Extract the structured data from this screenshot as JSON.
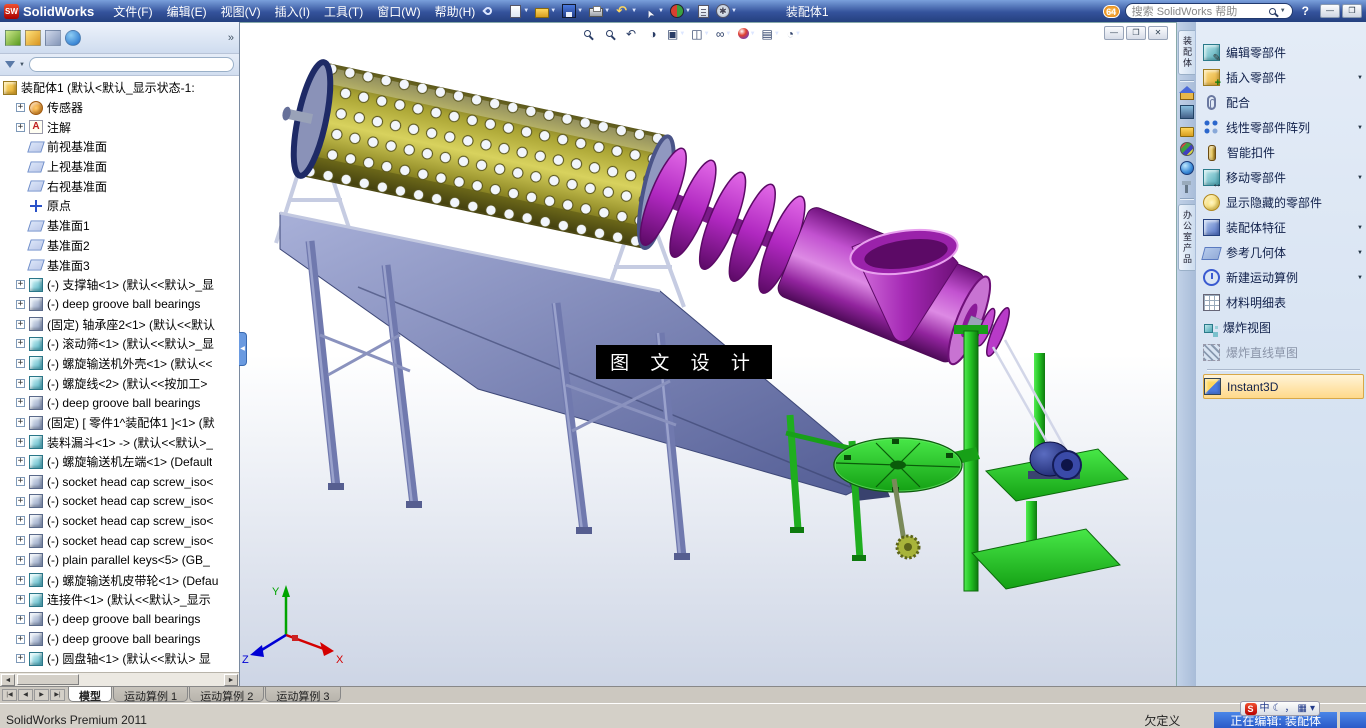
{
  "window": {
    "logo_badge": "SW",
    "logo_text": "SolidWorks",
    "menus": [
      "文件(F)",
      "编辑(E)",
      "视图(V)",
      "插入(I)",
      "工具(T)",
      "窗口(W)",
      "帮助(H)"
    ],
    "toolbar": [
      {
        "name": "new-document",
        "style": "doc",
        "arrow": true
      },
      {
        "name": "open-document",
        "style": "folder",
        "arrow": true
      },
      {
        "name": "save",
        "style": "save",
        "arrow": true
      },
      {
        "name": "print",
        "style": "print",
        "arrow": true
      },
      {
        "name": "undo",
        "style": "undo",
        "arrow": true
      },
      {
        "name": "select",
        "style": "cursor",
        "arrow": true
      },
      {
        "name": "rebuild",
        "style": "rebuild",
        "arrow": true
      },
      {
        "name": "file-properties",
        "style": "props",
        "arrow": false
      },
      {
        "name": "options",
        "style": "options",
        "arrow": true
      }
    ],
    "doc_title": "装配体1",
    "search": {
      "badge": "64",
      "placeholder": "搜索 SolidWorks 帮助",
      "dropdown_glyph": "▼"
    },
    "help_glyph": "?",
    "window_buttons": [
      {
        "name": "minimize-button",
        "glyph": "—"
      },
      {
        "name": "restore-button",
        "glyph": "❐"
      }
    ]
  },
  "left_panel": {
    "tabs": [
      {
        "name": "featuremanager-tab",
        "style": "fm"
      },
      {
        "name": "propertymanager-tab",
        "style": "pm"
      },
      {
        "name": "configurationmanager-tab",
        "style": "cm"
      },
      {
        "name": "displaymanager-tab",
        "style": "dm"
      }
    ],
    "chevron": "»",
    "filter_dropdown_glyph": "▼",
    "collapse_glyph": "◀",
    "hscroll": {
      "left_glyph": "◄",
      "right_glyph": "►"
    },
    "tree": {
      "items": [
        {
          "expand": "",
          "icon": "assembly",
          "label": "装配体1 (默认<默认_显示状态-1:"
        },
        {
          "expand": "+",
          "icon": "sensor",
          "label": "传感器"
        },
        {
          "expand": "+",
          "icon": "annotation",
          "label": "注解"
        },
        {
          "expand": "",
          "icon": "plane",
          "label": "前视基准面"
        },
        {
          "expand": "",
          "icon": "plane",
          "label": "上视基准面"
        },
        {
          "expand": "",
          "icon": "plane",
          "label": "右视基准面"
        },
        {
          "expand": "",
          "icon": "origin",
          "label": "原点"
        },
        {
          "expand": "",
          "icon": "plane",
          "label": "基准面1"
        },
        {
          "expand": "",
          "icon": "plane",
          "label": "基准面2"
        },
        {
          "expand": "",
          "icon": "plane",
          "label": "基准面3"
        },
        {
          "expand": "+",
          "icon": "part",
          "label": "(-) 支撑轴<1> (默认<<默认>_显"
        },
        {
          "expand": "+",
          "icon": "part2",
          "label": "(-) deep groove ball bearings"
        },
        {
          "expand": "+",
          "icon": "part2",
          "label": "(固定) 轴承座2<1> (默认<<默认"
        },
        {
          "expand": "+",
          "icon": "part",
          "label": "(-) 滚动筛<1> (默认<<默认>_显"
        },
        {
          "expand": "+",
          "icon": "part",
          "label": "(-) 螺旋输送机外壳<1> (默认<<"
        },
        {
          "expand": "+",
          "icon": "part",
          "label": "(-) 螺旋线<2> (默认<<按加工>"
        },
        {
          "expand": "+",
          "icon": "part2",
          "label": "(-) deep groove ball bearings"
        },
        {
          "expand": "+",
          "icon": "part2",
          "label": "(固定) [ 零件1^装配体1 ]<1> (默"
        },
        {
          "expand": "+",
          "icon": "part",
          "label": "装料漏斗<1> -> (默认<<默认>_"
        },
        {
          "expand": "+",
          "icon": "part",
          "label": "(-) 螺旋输送机左端<1> (Default"
        },
        {
          "expand": "+",
          "icon": "part2",
          "label": "(-) socket head cap screw_iso<"
        },
        {
          "expand": "+",
          "icon": "part2",
          "label": "(-) socket head cap screw_iso<"
        },
        {
          "expand": "+",
          "icon": "part2",
          "label": "(-) socket head cap screw_iso<"
        },
        {
          "expand": "+",
          "icon": "part2",
          "label": "(-) socket head cap screw_iso<"
        },
        {
          "expand": "+",
          "icon": "part2",
          "label": "(-) plain parallel keys<5> (GB_"
        },
        {
          "expand": "+",
          "icon": "part",
          "label": "(-) 螺旋输送机皮带轮<1> (Defau"
        },
        {
          "expand": "+",
          "icon": "part",
          "label": "连接件<1> (默认<<默认>_显示"
        },
        {
          "expand": "+",
          "icon": "part2",
          "label": "(-) deep groove ball bearings"
        },
        {
          "expand": "+",
          "icon": "part2",
          "label": "(-) deep groove ball bearings"
        },
        {
          "expand": "+",
          "icon": "part",
          "label": "(-) 圆盘轴<1> (默认<<默认> 显"
        }
      ]
    }
  },
  "viewport": {
    "hud": [
      {
        "name": "zoom-to-fit",
        "style": "mag"
      },
      {
        "name": "zoom-to-area",
        "style": "mag"
      },
      {
        "name": "previous-view",
        "glyph": "↶"
      },
      {
        "name": "section-view",
        "glyph": "◑"
      },
      {
        "name": "view-orientation",
        "glyph": "▣",
        "arrow": true
      },
      {
        "name": "display-style",
        "glyph": "◫",
        "arrow": true
      },
      {
        "name": "hide-show-items",
        "glyph": "∞",
        "arrow": true
      },
      {
        "name": "edit-appearance",
        "style": "ball",
        "arrow": true
      },
      {
        "name": "apply-scene",
        "glyph": "▤",
        "arrow": true
      },
      {
        "name": "view-settings",
        "glyph": "◔",
        "arrow": true
      }
    ],
    "doc_controls": [
      {
        "name": "doc-minimize-button",
        "glyph": "—"
      },
      {
        "name": "doc-restore-button",
        "glyph": "❐"
      },
      {
        "name": "doc-close-button",
        "glyph": "✕"
      }
    ],
    "watermark": "图 文 设 计",
    "triad": {
      "x": "X",
      "y": "Y",
      "z": "Z"
    }
  },
  "command_strip": {
    "top_tab": "装配体",
    "icons": [
      {
        "name": "solidworks-resources-tab-icon",
        "style": "home"
      },
      {
        "name": "design-library-tab-icon",
        "style": "display"
      },
      {
        "name": "file-explorer-tab-icon",
        "style": "folder"
      },
      {
        "name": "view-palette-tab-icon",
        "style": "palette"
      },
      {
        "name": "appearances-scenes-tab-icon",
        "style": "globe"
      },
      {
        "name": "auto-show-pin-icon",
        "style": "pin"
      }
    ],
    "bottom_tab": "办公室产品"
  },
  "command_panel": {
    "items": [
      {
        "name": "edit-component",
        "icon": "edit",
        "label": "编辑零部件"
      },
      {
        "name": "insert-component",
        "icon": "insert",
        "label": "插入零部件",
        "arrow": true
      },
      {
        "name": "mate",
        "icon": "mate",
        "label": "配合"
      },
      {
        "name": "linear-component-pattern",
        "icon": "pattern",
        "label": "线性零部件阵列",
        "arrow": true
      },
      {
        "name": "smart-fasteners",
        "icon": "fastener",
        "label": "智能扣件"
      },
      {
        "name": "move-component",
        "icon": "move",
        "label": "移动零部件",
        "arrow": true
      },
      {
        "name": "show-hidden-components",
        "icon": "showhide",
        "label": "显示隐藏的零部件"
      },
      {
        "name": "assembly-features",
        "icon": "feature",
        "label": "装配体特征",
        "arrow": true
      },
      {
        "name": "reference-geometry",
        "icon": "refgeo",
        "label": "参考几何体",
        "arrow": true
      },
      {
        "name": "new-motion-study",
        "icon": "motion",
        "label": "新建运动算例",
        "arrow": true
      },
      {
        "name": "bill-of-materials",
        "icon": "bom",
        "label": "材料明细表"
      },
      {
        "name": "exploded-view",
        "icon": "explode",
        "label": "爆炸视图"
      },
      {
        "name": "explode-line-sketch",
        "icon": "explline",
        "label": "爆炸直线草图",
        "disabled": true,
        "sep_after": true
      },
      {
        "name": "instant3d",
        "icon": "instant3d",
        "label": "Instant3D",
        "active": true
      }
    ]
  },
  "bottom": {
    "nav": [
      "|◀",
      "◀",
      "▶",
      "▶|"
    ],
    "tabs": [
      {
        "label": "模型",
        "active": true
      },
      {
        "label": "运动算例 1"
      },
      {
        "label": "运动算例 2"
      },
      {
        "label": "运动算例 3"
      }
    ]
  },
  "status": {
    "left": "SolidWorks Premium 2011",
    "state": "欠定义",
    "editing": "正在编辑: 装配体"
  },
  "ime": {
    "items": [
      {
        "name": "sogou-icon",
        "glyph": "S",
        "style": "s"
      },
      {
        "name": "lang-mode-icon",
        "glyph": "中"
      },
      {
        "name": "fullwidth-icon",
        "glyph": "☾"
      },
      {
        "name": "punctuation-icon",
        "glyph": "，"
      },
      {
        "name": "keyboard-icon",
        "glyph": "▦"
      },
      {
        "name": "ime-menu-icon",
        "glyph": "▾"
      }
    ]
  },
  "colors": {
    "titlebar_blue": "#35539c",
    "panel_blue": "#cddcee",
    "status_edit_blue": "#2a5ac8",
    "badge_orange": "#e07b00",
    "drum_olive": "#b8b23a",
    "auger_magenta": "#b028c0",
    "frame_steel_blue": "#7079ae",
    "stand_green": "#22c022",
    "watermark_bg": "#000000"
  }
}
